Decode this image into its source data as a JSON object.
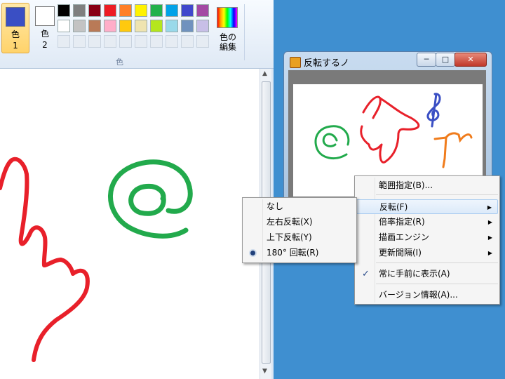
{
  "paint": {
    "color1_label": "色",
    "color1_num": "1",
    "color2_label": "色",
    "color2_num": "2",
    "color1_value": "#3a4fc4",
    "color2_value": "#ffffff",
    "edit_colors_label1": "色の",
    "edit_colors_label2": "編集",
    "group_label": "色",
    "palette_row1": [
      "#000000",
      "#7f7f7f",
      "#880015",
      "#ed1c24",
      "#ff7f27",
      "#fff200",
      "#22b14c",
      "#00a2e8",
      "#3f48cc",
      "#a349a4"
    ],
    "palette_row2": [
      "#ffffff",
      "#c3c3c3",
      "#b97a57",
      "#ffaec9",
      "#ffc90e",
      "#efe4b0",
      "#b5e61d",
      "#99d9ea",
      "#7092be",
      "#c8bfe7"
    ]
  },
  "hanten": {
    "title": "反転するノ",
    "min_glyph": "─",
    "max_glyph": "□",
    "close_glyph": "✕"
  },
  "menu": {
    "items": [
      {
        "label": "範囲指定(B)..."
      },
      {
        "label": "反転(F)",
        "arrow": "▶"
      },
      {
        "label": "倍率指定(R)",
        "arrow": "▶"
      },
      {
        "label": "描画エンジン",
        "arrow": "▶"
      },
      {
        "label": "更新間隔(I)",
        "arrow": "▶"
      },
      {
        "label": "常に手前に表示(A)",
        "check": "✓"
      },
      {
        "label": "バージョン情報(A)..."
      }
    ]
  },
  "submenu": {
    "items": [
      {
        "label": "なし"
      },
      {
        "label": "左右反転(X)"
      },
      {
        "label": "上下反転(Y)"
      },
      {
        "label": "180° 回転(R)"
      }
    ]
  }
}
